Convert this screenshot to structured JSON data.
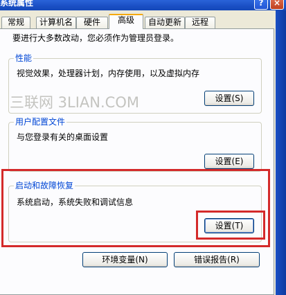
{
  "window": {
    "title": "系统属性",
    "help_glyph": "?",
    "close_glyph": "×"
  },
  "tabs": [
    {
      "label": "常规"
    },
    {
      "label": "计算机名"
    },
    {
      "label": "硬件"
    },
    {
      "label": "高级",
      "active": true
    },
    {
      "label": "自动更新"
    },
    {
      "label": "远程"
    }
  ],
  "intro": "要进行大多数改动，您必须作为管理员登录。",
  "performance": {
    "title": "性能",
    "description": "视觉效果，处理器计划，内存使用，以及虚拟内存",
    "button": "设置(S)"
  },
  "user_profiles": {
    "title": "用户配置文件",
    "description": "与您登录有关的桌面设置",
    "button": "设置(E)"
  },
  "startup_recovery": {
    "title": "启动和故障恢复",
    "description": "系统启动，系统失败和调试信息",
    "button": "设置(T)"
  },
  "bottom_buttons": {
    "env_vars": "环境变量(N)",
    "error_report": "错误报告(R)"
  },
  "watermark": "三联网 3LIAN.COM",
  "colors": {
    "highlight": "#d42a2a",
    "group_title": "#0046d5",
    "tab_active_accent": "#f5a90e"
  }
}
